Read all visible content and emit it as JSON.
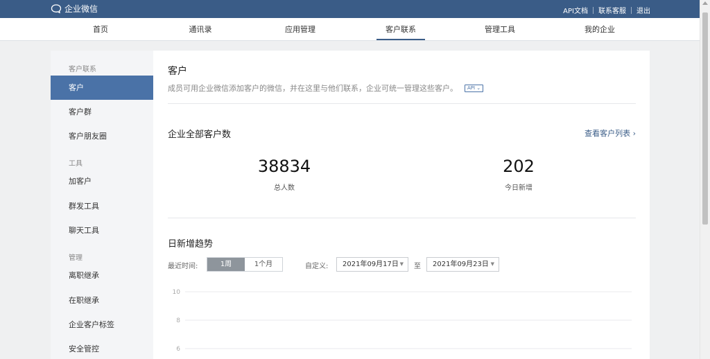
{
  "app": {
    "name": "企业微信",
    "top_links": [
      "API文档",
      "联系客服",
      "退出"
    ]
  },
  "nav": {
    "items": [
      {
        "label": "首页"
      },
      {
        "label": "通讯录"
      },
      {
        "label": "应用管理"
      },
      {
        "label": "客户联系",
        "active": true
      },
      {
        "label": "管理工具"
      },
      {
        "label": "我的企业"
      }
    ]
  },
  "sidebar": {
    "groups": [
      {
        "title": "客户联系",
        "items": [
          "客户",
          "客户群",
          "客户朋友圈"
        ]
      },
      {
        "title": "工具",
        "items": [
          "加客户",
          "群发工具",
          "聊天工具"
        ]
      },
      {
        "title": "管理",
        "items": [
          "离职继承",
          "在职继承",
          "企业客户标签",
          "安全管控"
        ]
      }
    ],
    "active": "客户"
  },
  "main": {
    "title": "客户",
    "description": "成员可用企业微信添加客户的微信，并在这里与他们联系，企业可统一管理这些客户。",
    "api_badge": "API",
    "total_section": {
      "title": "企业全部客户数",
      "link": "查看客户列表 ›",
      "stats": [
        {
          "value": "38834",
          "label": "总人数"
        },
        {
          "value": "202",
          "label": "今日新增"
        }
      ]
    },
    "trend_section": {
      "title": "日新增趋势",
      "recent_label": "最近时间:",
      "recent_options": [
        "1周",
        "1个月"
      ],
      "recent_selected": "1周",
      "custom_label": "自定义:",
      "start_date": "2021年09月17日",
      "to_label": "至",
      "end_date": "2021年09月23日"
    }
  },
  "chart_data": {
    "type": "line",
    "x": [],
    "series": [],
    "yticks": [
      10,
      8,
      6
    ],
    "grid": true
  },
  "colors": {
    "topbar": "#3a5c87",
    "accent": "#4a72a7",
    "link": "#3a5c87"
  }
}
